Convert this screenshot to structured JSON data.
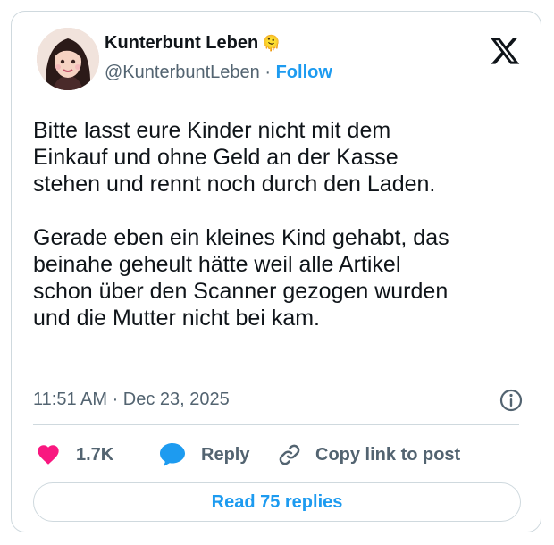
{
  "author": {
    "display_name": "Kunterbunt Leben",
    "name_emoji": "🫠",
    "handle": "@KunterbuntLeben",
    "separator": "·",
    "follow_label": "Follow"
  },
  "tweet": {
    "text": "Bitte lasst eure Kinder nicht mit dem\nEinkauf und ohne Geld an der Kasse\nstehen und rennt noch durch den Laden.\n\nGerade eben ein kleines Kind gehabt, das\nbeinahe geheult hätte weil alle Artikel\nschon über den Scanner gezogen wurden\nund die Mutter nicht bei kam.",
    "timestamp": "11:51 AM · Dec 23, 2025"
  },
  "actions": {
    "like_count": "1.7K",
    "reply_label": "Reply",
    "copy_label": "Copy link to post"
  },
  "read_replies_label": "Read 75 replies",
  "colors": {
    "accent": "#1d9bf0",
    "like": "#f91880",
    "muted": "#536471",
    "border": "#cfd9de"
  },
  "icons": [
    "x-logo-icon",
    "info-icon",
    "heart-icon",
    "reply-bubble-icon",
    "link-icon"
  ]
}
